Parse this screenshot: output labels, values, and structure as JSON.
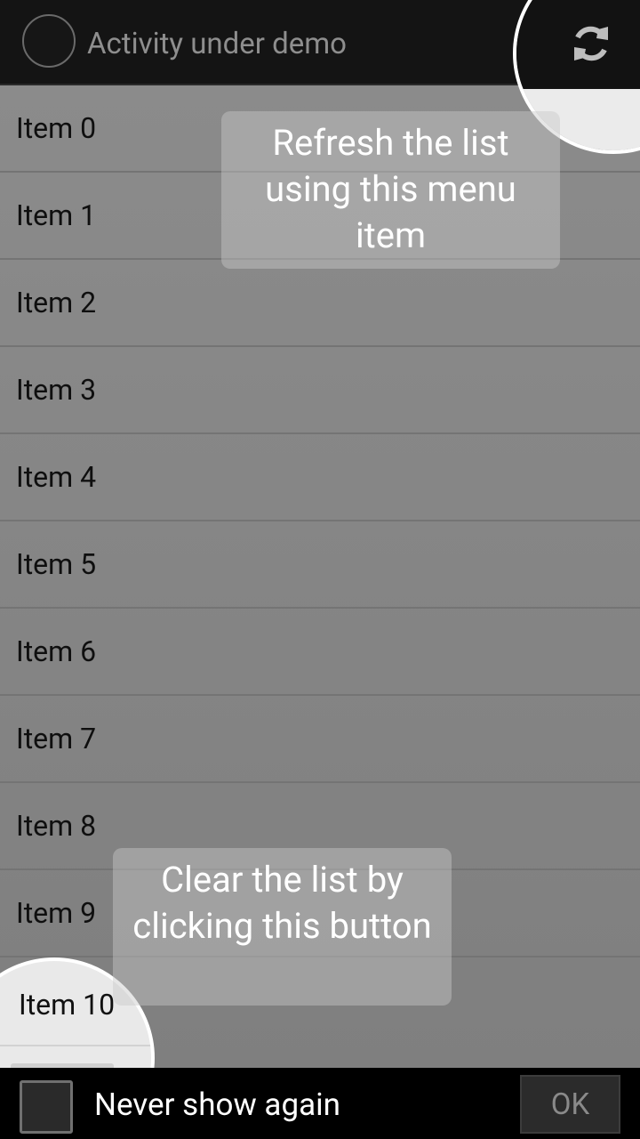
{
  "action_bar": {
    "title": "Activity under demo",
    "refresh_icon": "refresh-icon"
  },
  "list": {
    "items": [
      "Item 0",
      "Item 1",
      "Item 2",
      "Item 3",
      "Item 4",
      "Item 5",
      "Item 6",
      "Item 7",
      "Item 8",
      "Item 9"
    ]
  },
  "highlighted_item": "Item 10",
  "tips": {
    "refresh": "Refresh the list using this menu item",
    "clear": "Clear the list by clicking this button"
  },
  "bottom_bar": {
    "checkbox_label": "Never show again",
    "checkbox_checked": false,
    "ok_label": "OK"
  },
  "colors": {
    "overlay": "#8a8a8a",
    "action_bar": "#141414",
    "highlight_ring": "#ffffff"
  }
}
